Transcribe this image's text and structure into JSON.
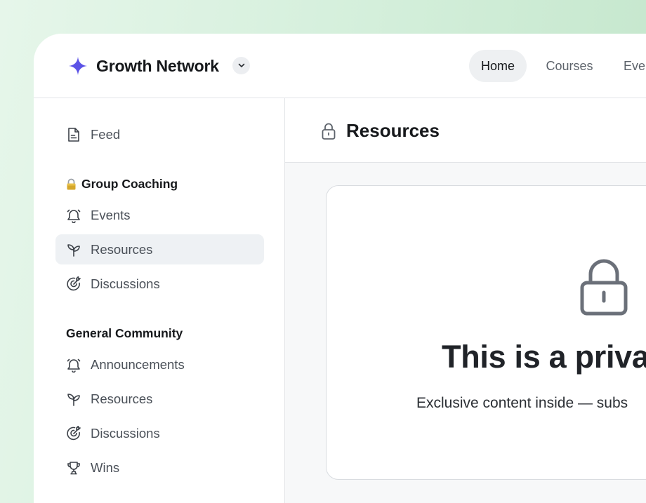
{
  "brand": {
    "name": "Growth Network",
    "icon": "sparkle-icon",
    "accent": "#5b52e6"
  },
  "nav": {
    "tabs": [
      {
        "label": "Home",
        "active": true
      },
      {
        "label": "Courses",
        "active": false
      },
      {
        "label": "Eve",
        "active": false
      }
    ]
  },
  "sidebar": {
    "feed": {
      "label": "Feed",
      "icon": "document-icon"
    },
    "sections": [
      {
        "title": "Group Coaching",
        "title_icon": "lock-emoji-icon",
        "items": [
          {
            "label": "Events",
            "icon": "bell-icon"
          },
          {
            "label": "Resources",
            "icon": "sprout-icon",
            "active": true
          },
          {
            "label": "Discussions",
            "icon": "target-icon"
          }
        ]
      },
      {
        "title": "General Community",
        "items": [
          {
            "label": "Announcements",
            "icon": "bell-icon"
          },
          {
            "label": "Resources",
            "icon": "sprout-icon"
          },
          {
            "label": "Discussions",
            "icon": "target-icon"
          },
          {
            "label": "Wins",
            "icon": "trophy-icon"
          }
        ]
      }
    ]
  },
  "main": {
    "title": "Resources",
    "title_icon": "lock-icon",
    "card": {
      "title": "This is a privat",
      "subtitle": "Exclusive content inside — subs",
      "icon": "lock-icon"
    }
  }
}
